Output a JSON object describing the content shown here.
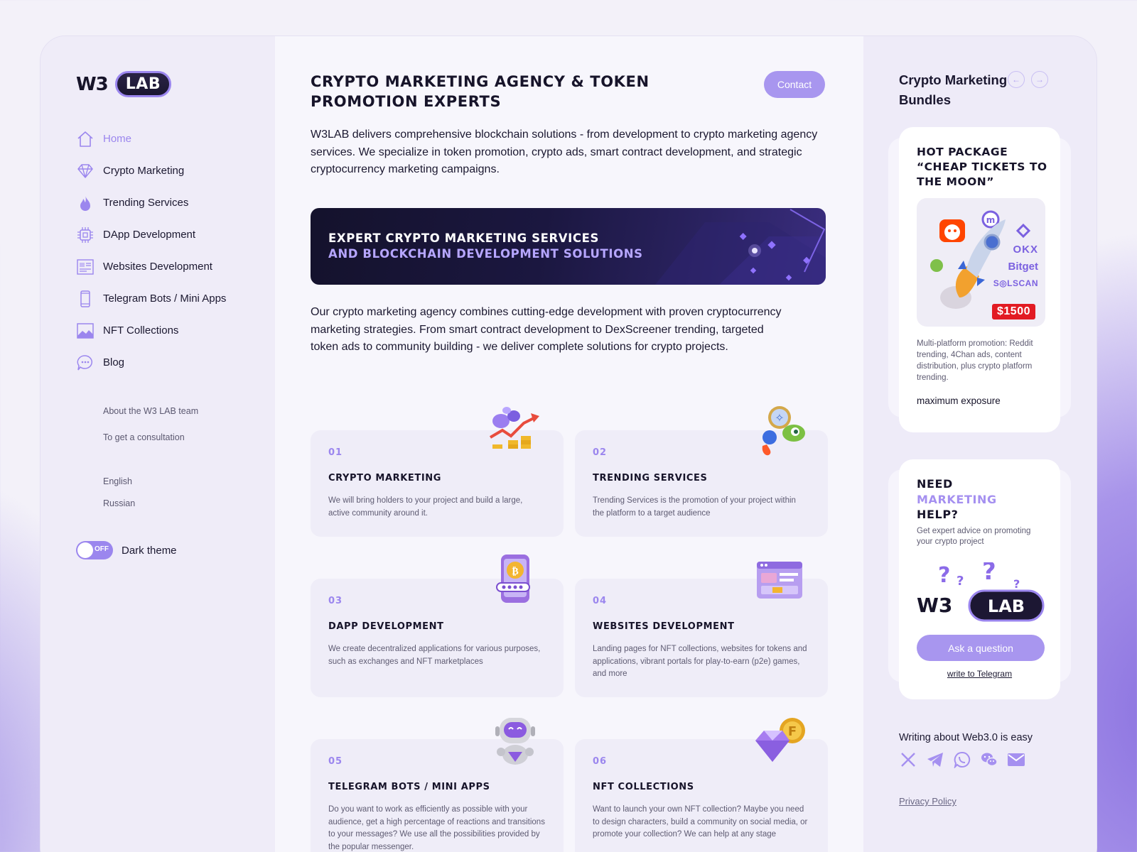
{
  "brand": {
    "logo_left": "W3",
    "logo_right": "LAB"
  },
  "nav": [
    {
      "label": "Home",
      "icon": "home-icon",
      "active": true
    },
    {
      "label": "Crypto Marketing",
      "icon": "diamond-icon"
    },
    {
      "label": "Trending Services",
      "icon": "fire-icon"
    },
    {
      "label": "DApp Development",
      "icon": "chip-icon"
    },
    {
      "label": "Websites Development",
      "icon": "website-icon"
    },
    {
      "label": "Telegram Bots / Mini Apps",
      "icon": "phone-icon"
    },
    {
      "label": "NFT Collections",
      "icon": "image-icon"
    },
    {
      "label": "Blog",
      "icon": "chat-icon"
    }
  ],
  "sub_links": [
    "About the W3 LAB team",
    "To get a consultation"
  ],
  "languages": [
    "English",
    "Russian"
  ],
  "theme": {
    "toggle_state": "OFF",
    "label": "Dark theme"
  },
  "main": {
    "title": "Crypto Marketing Agency & Token Promotion Experts",
    "contact_label": "Contact",
    "intro": "W3LAB delivers comprehensive blockchain solutions - from development to crypto marketing agency services. We specialize in token promotion, crypto ads, smart contract development, and strategic cryptocurrency marketing campaigns.",
    "banner_line1": "Expert Crypto Marketing Services",
    "banner_line2": "and Blockchain Development Solutions",
    "para2": "Our crypto marketing agency combines cutting-edge development with proven cryptocurrency marketing strategies. From smart contract development to DexScreener trending, targeted token ads to community building - we deliver complete solutions for crypto projects."
  },
  "services": [
    {
      "num": "01",
      "title": "Crypto Marketing",
      "desc": "We will bring holders to your project and build a large, active community around it."
    },
    {
      "num": "02",
      "title": "Trending Services",
      "desc": "Trending Services is the promotion of your project within the platform to a target audience"
    },
    {
      "num": "03",
      "title": "DApp Development",
      "desc": "We create decentralized applications for various purposes, such as exchanges and NFT marketplaces"
    },
    {
      "num": "04",
      "title": "Websites Development",
      "desc": "Landing pages for NFT collections, websites for tokens and applications, vibrant portals for play-to-earn (p2e) games, and more"
    },
    {
      "num": "05",
      "title": "Telegram Bots / Mini Apps",
      "desc": "Do you want to work as efficiently as possible with your audience, get a high percentage of reactions and transitions to your messages? We use all the possibilities provided by the popular messenger."
    },
    {
      "num": "06",
      "title": "NFT Collections",
      "desc": "Want to launch your own NFT collection? Maybe you need to design characters, build a community on social media, or promote your collection? We can help at any stage"
    }
  ],
  "right": {
    "title": "Crypto Marketing Bundles",
    "package": {
      "heading": "Hot package “Cheap tickets to the moon”",
      "price": "$1500",
      "brands": [
        "OKX",
        "Bitget",
        "S◎LSCAN"
      ],
      "desc": "Multi-platform promotion: Reddit trending, 4Chan ads, content distribution, plus crypto platform trending.",
      "footer": "maximum exposure"
    },
    "help": {
      "line1": "Need",
      "line2": "Marketing",
      "line3": "Help?",
      "sub": "Get expert advice on promoting your crypto project",
      "ask_label": "Ask a question",
      "telegram_link": "write to Telegram"
    },
    "writing": "Writing about Web3.0 is easy",
    "socials": [
      "x-icon",
      "telegram-icon",
      "whatsapp-icon",
      "wechat-icon",
      "mail-icon"
    ],
    "privacy": "Privacy Policy"
  },
  "colors": {
    "accent": "#9b86ee",
    "dark": "#17142a",
    "price_red": "#e21b23"
  }
}
